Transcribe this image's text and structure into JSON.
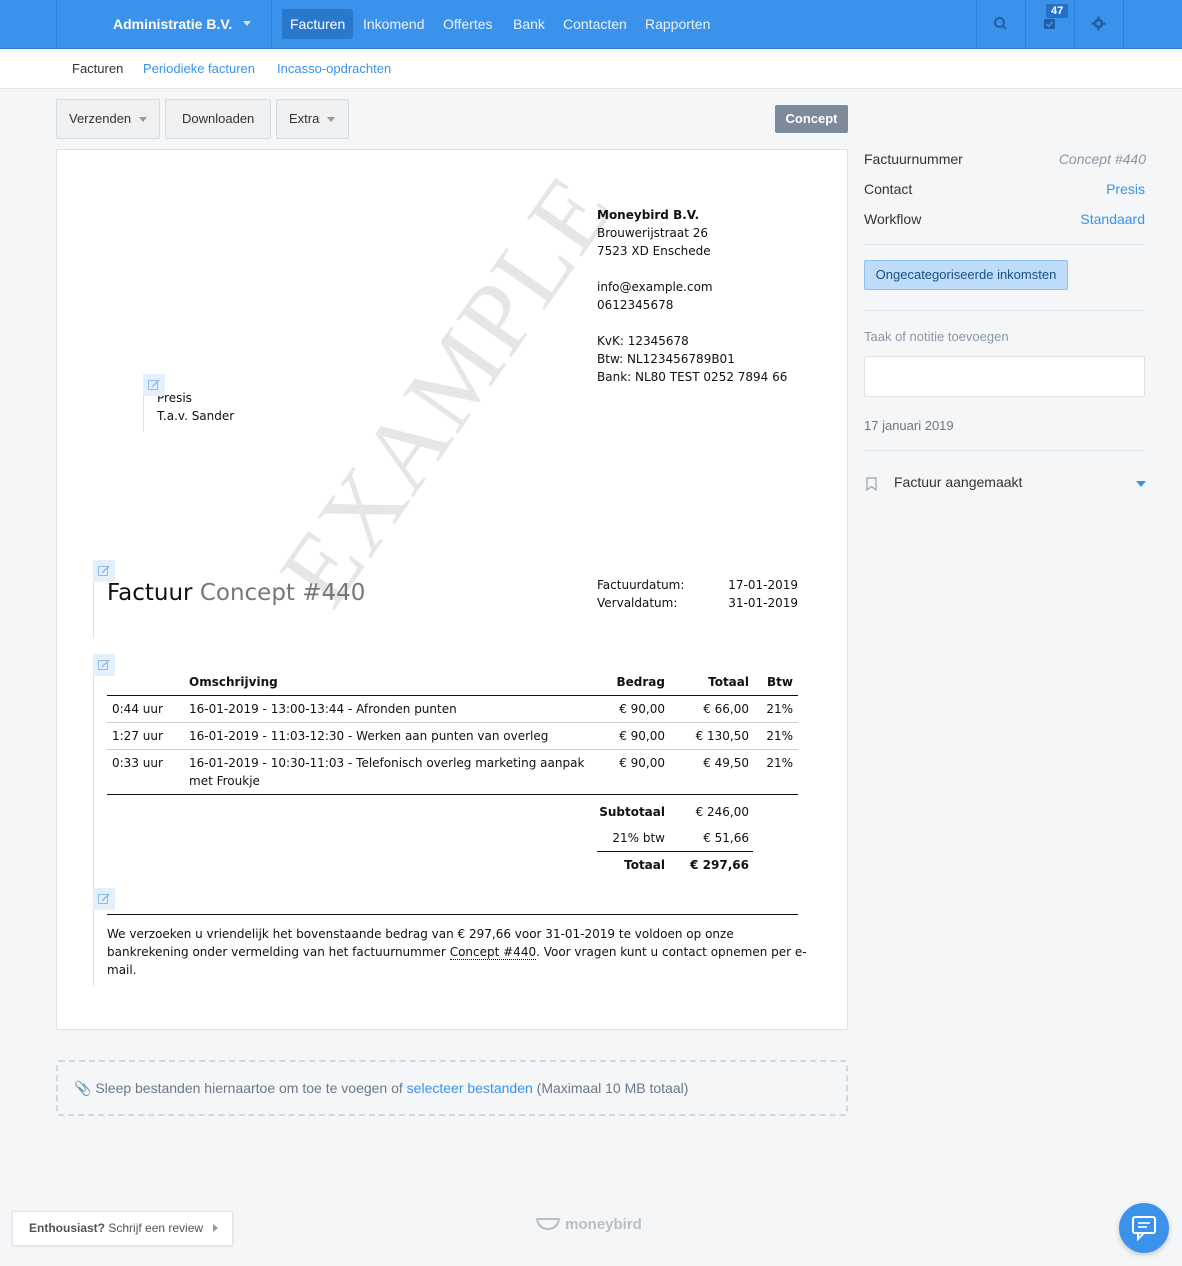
{
  "topbar": {
    "org": "Administratie B.V.",
    "nav": [
      "Facturen",
      "Inkomend",
      "Offertes",
      "Bank",
      "Contacten",
      "Rapporten"
    ],
    "active_nav": "Facturen",
    "tasks_count": "47",
    "icons": [
      "search-icon",
      "tasks-icon",
      "settings-gear-icon"
    ],
    "colors": {
      "bar": "#3b92ea",
      "accent": "#3b92ea"
    }
  },
  "subnav": {
    "items": [
      "Facturen",
      "Periodieke facturen",
      "Incasso-opdrachten"
    ],
    "active": "Facturen"
  },
  "toolbar": {
    "send": "Verzenden",
    "download": "Downloaden",
    "extra": "Extra",
    "status": "Concept"
  },
  "invoice": {
    "watermark": "EXAMPLE",
    "sender": {
      "name": "Moneybird B.V.",
      "street": "Brouwerijstraat 26",
      "city": "7523 XD Enschede",
      "email": "info@example.com",
      "phone": "0612345678",
      "kvk": "KvK: 12345678",
      "btw": "Btw: NL123456789B01",
      "bank": "Bank: NL80 TEST 0252 7894 66"
    },
    "recipient": {
      "name": "Presis",
      "attn": "T.a.v. Sander"
    },
    "title_word": "Factuur",
    "title_number": "Concept #440",
    "dates": {
      "invoice_label": "Factuurdatum:",
      "invoice_value": "17-01-2019",
      "due_label": "Vervaldatum:",
      "due_value": "31-01-2019"
    },
    "columns": {
      "description": "Omschrijving",
      "amount": "Bedrag",
      "total": "Totaal",
      "vat": "Btw"
    },
    "rows": [
      {
        "qty": "0:44 uur",
        "desc": "16-01-2019 - 13:00-13:44 - Afronden punten",
        "desc2": "",
        "amount": "€ 90,00",
        "total": "€ 66,00",
        "vat": "21%"
      },
      {
        "qty": "1:27 uur",
        "desc": "16-01-2019 - 11:03-12:30 - Werken aan punten van overleg",
        "desc2": "",
        "amount": "€ 90,00",
        "total": "€ 130,50",
        "vat": "21%"
      },
      {
        "qty": "0:33 uur",
        "desc": "16-01-2019 - 10:30-11:03 - Telefonisch overleg marketing aanpak",
        "desc2": "met Froukje",
        "amount": "€ 90,00",
        "total": "€ 49,50",
        "vat": "21%"
      }
    ],
    "totals": {
      "subtotal_label": "Subtotaal",
      "subtotal": "€ 246,00",
      "vat_label": "21% btw",
      "vat": "€ 51,66",
      "total_label": "Totaal",
      "total": "€ 297,66"
    },
    "footer": {
      "line1": "We verzoeken u vriendelijk het bovenstaande bedrag van € 297,66 voor 31-01-2019 te voldoen op onze",
      "line2_pre": "bankrekening onder vermelding van het factuurnummer ",
      "line2_num": "Concept #440",
      "line2_post": ". Voor vragen kunt u contact opnemen per e-",
      "line3": "mail."
    }
  },
  "sidebar": {
    "invoice_number_label": "Factuurnummer",
    "invoice_number_value": "Concept #440",
    "contact_label": "Contact",
    "contact_value": "Presis",
    "workflow_label": "Workflow",
    "workflow_value": "Standaard",
    "category_button": "Ongecategoriseerde inkomsten",
    "note_label": "Taak of notitie toevoegen",
    "note_value": "",
    "date": "17 januari 2019",
    "event": "Factuur aangemaakt"
  },
  "dropzone": {
    "pre": "Sleep bestanden hiernaartoe om toe te voegen of ",
    "link": "selecteer bestanden",
    "post": " (Maximaal 10 MB totaal)"
  },
  "footer": {
    "review_bold": "Enthousiast?",
    "review_text": " Schrijf een review",
    "logo": "moneybird"
  }
}
